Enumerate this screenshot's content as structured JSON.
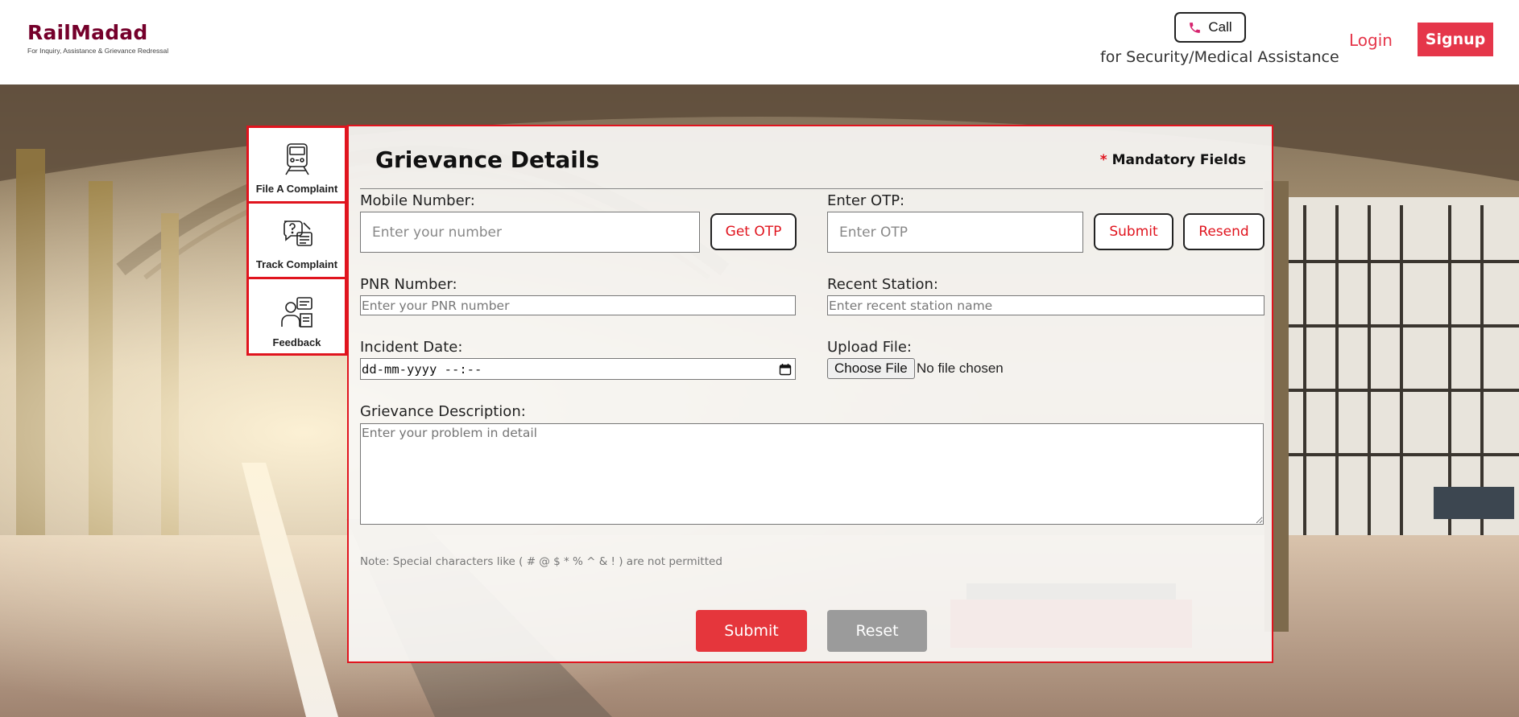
{
  "header": {
    "logo_title": "RailMadad",
    "logo_tagline": "For Inquiry, Assistance & Grievance Redressal",
    "call_label": "Call",
    "call_caption": "for Security/Medical Assistance",
    "login_label": "Login",
    "signup_label": "Signup"
  },
  "side_menu": {
    "items": [
      {
        "label": "File A Complaint",
        "icon": "train-icon"
      },
      {
        "label": "Track Complaint",
        "icon": "complaint-tracking-icon"
      },
      {
        "label": "Feedback",
        "icon": "feedback-person-icon"
      }
    ]
  },
  "form": {
    "title": "Grievance Details",
    "mandatory_star": "*",
    "mandatory_text": "Mandatory Fields",
    "mobile_label": "Mobile Number:",
    "mobile_placeholder": "Enter your number",
    "get_otp_label": "Get OTP",
    "otp_label": "Enter OTP:",
    "otp_placeholder": "Enter OTP",
    "otp_submit_label": "Submit",
    "otp_resend_label": "Resend",
    "pnr_label": "PNR Number:",
    "pnr_placeholder": "Enter your PNR number",
    "station_label": "Recent Station:",
    "station_placeholder": "Enter recent station name",
    "incident_label": "Incident Date:",
    "incident_value": "dd-mm-yyyy --:--",
    "upload_label": "Upload File:",
    "choose_file_label": "Choose File",
    "file_status": "No file chosen",
    "description_label": "Grievance Description:",
    "description_placeholder": "Enter your problem in detail",
    "note": "Note: Special characters like ( # @ $ * % ^ & ! ) are not permitted",
    "submit_label": "Submit",
    "reset_label": "Reset"
  },
  "colors": {
    "brand": "#75002b",
    "accent": "#e5364a",
    "border_red": "#e0141e",
    "reset_gray": "#9b9b9b"
  }
}
